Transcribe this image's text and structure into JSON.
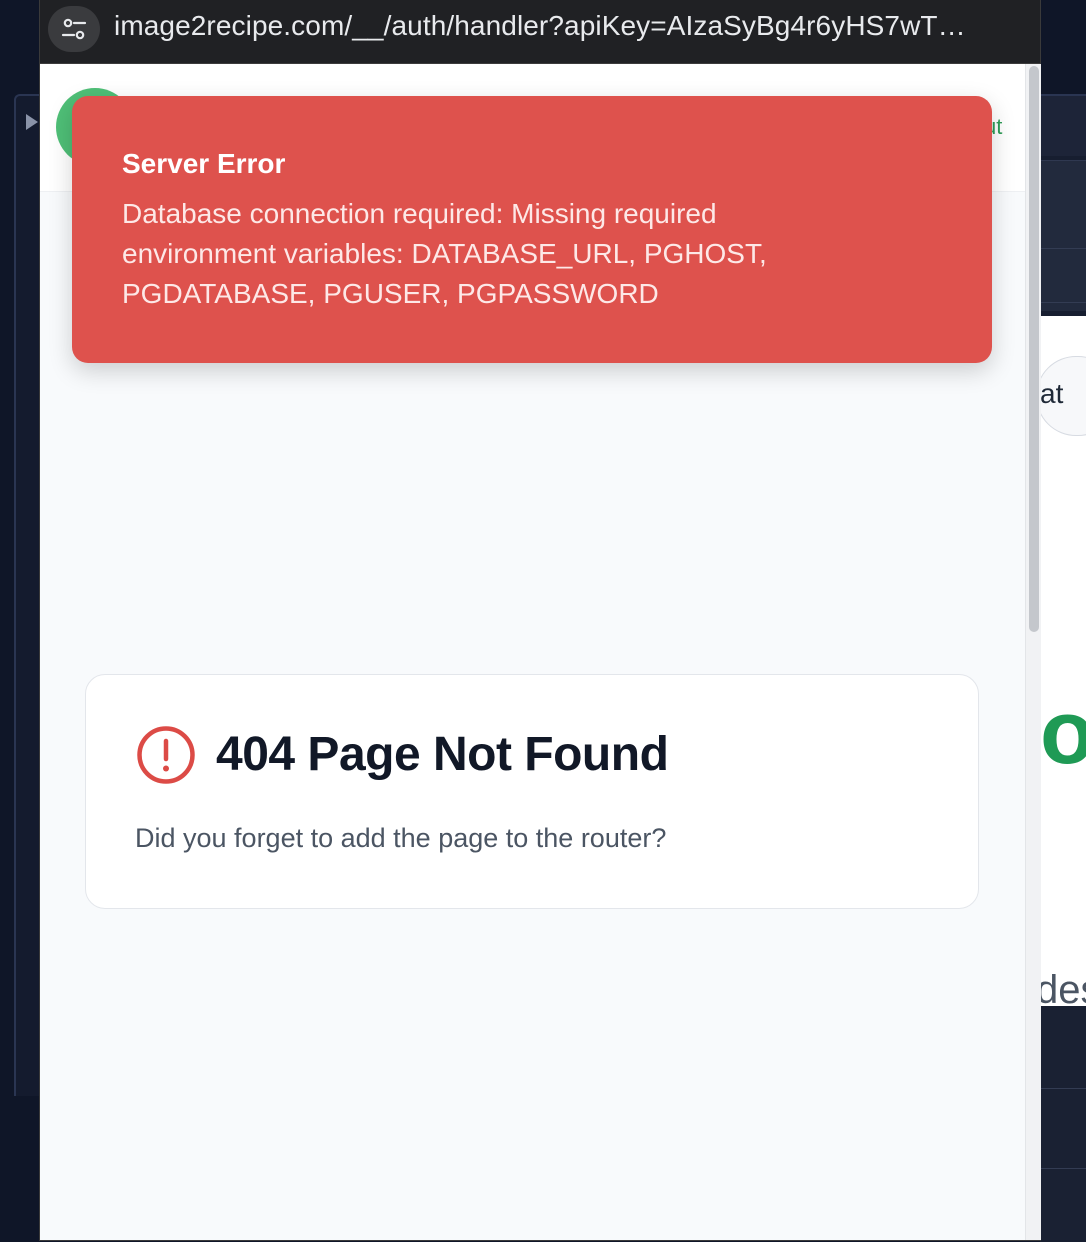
{
  "browser": {
    "url": "image2recipe.com/__/auth/handler?apiKey=AIzaSyBg4r6yHS7wT…"
  },
  "header": {
    "link_fragment": "ut"
  },
  "toast": {
    "title": "Server Error",
    "message": "Database connection required: Missing required environment variables: DATABASE_URL, PGHOST, PGDATABASE, PGUSER, PGPASSWORD",
    "color": "#de524d"
  },
  "not_found": {
    "title": "404 Page Not Found",
    "message": "Did you forget to add the page to the router?",
    "icon": "alert-circle-icon",
    "icon_color": "#dc4b46"
  },
  "background_app": {
    "pill_fragment": "at",
    "heading_fragment": "ot",
    "subtitle_fragment": "des"
  },
  "colors": {
    "accent_green": "#2e9d57",
    "error_red": "#de524d"
  }
}
